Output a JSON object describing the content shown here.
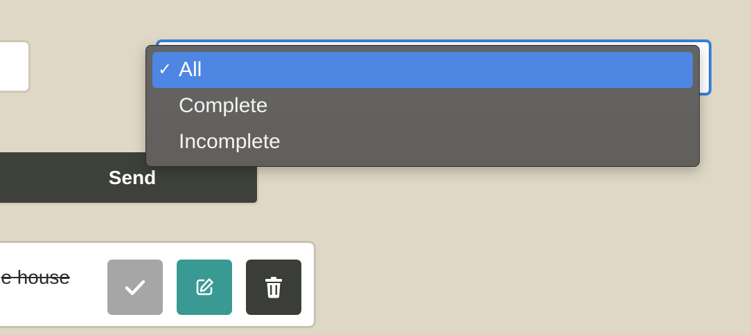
{
  "send_button": {
    "label": "Send"
  },
  "filter_menu": {
    "selected": "All",
    "options": [
      {
        "label": "All",
        "checked": true
      },
      {
        "label": "Complete",
        "checked": false
      },
      {
        "label": "Incomplete",
        "checked": false
      }
    ]
  },
  "todo": {
    "text": "e house",
    "completed": true,
    "actions": [
      {
        "icon": "check-icon",
        "color": "#a6a6a6"
      },
      {
        "icon": "edit-icon",
        "color": "#389a92"
      },
      {
        "icon": "trash-icon",
        "color": "#3b3d39"
      }
    ]
  },
  "colors": {
    "background": "#dfd8c6",
    "accent": "#3a7fd5",
    "menu_highlight": "#4e87e3"
  }
}
